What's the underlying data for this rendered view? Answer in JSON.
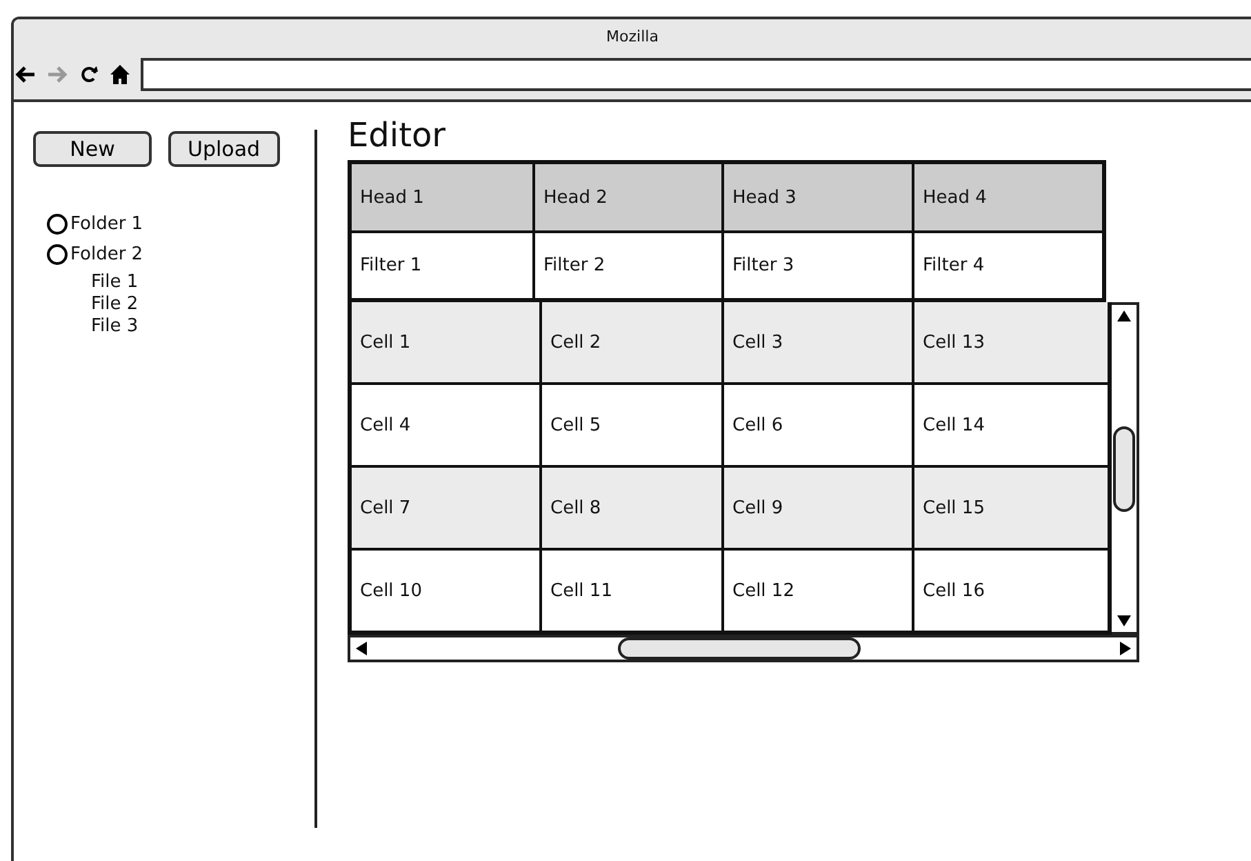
{
  "window": {
    "title": "Mozilla"
  },
  "sidebar": {
    "buttons": [
      "New",
      "Upload"
    ],
    "tree": [
      {
        "label": "Folder 1",
        "selected": false
      },
      {
        "label": "Folder 2",
        "selected": false,
        "children": [
          {
            "label": "File 1"
          },
          {
            "label": "File 2"
          },
          {
            "label": "File 3"
          }
        ]
      }
    ]
  },
  "editor": {
    "title": "Editor",
    "table": {
      "columns": [
        "Head 1",
        "Head 2",
        "Head 3",
        "Head 4"
      ],
      "filters": [
        "Filter 1",
        "Filter 2",
        "Filter 3",
        "Filter 4"
      ],
      "rows": [
        [
          "Cell 1",
          "Cell 2",
          "Cell 3",
          "Cell 13"
        ],
        [
          "Cell 4",
          "Cell 5",
          "Cell 6",
          "Cell 14"
        ],
        [
          "Cell 7",
          "Cell 8",
          "Cell 9",
          "Cell 15"
        ],
        [
          "Cell 10",
          "Cell 11",
          "Cell 12",
          "Cell 16"
        ]
      ]
    }
  }
}
